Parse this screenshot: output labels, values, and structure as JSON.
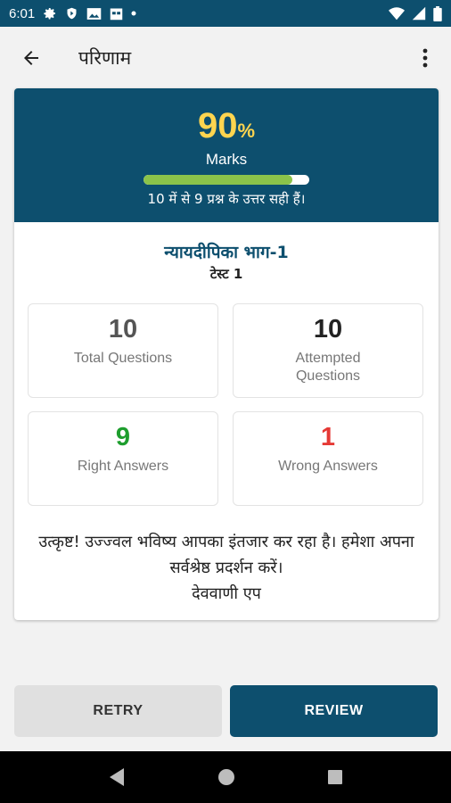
{
  "status_bar": {
    "time": "6:01",
    "icons": [
      "gear-icon",
      "shield-play-icon",
      "image-icon",
      "calendar-icon",
      "dot-icon",
      "wifi-icon",
      "signal-icon",
      "battery-icon"
    ]
  },
  "app_bar": {
    "title": "परिणाम",
    "back_icon": "arrow-left-icon",
    "menu_icon": "more-vertical-icon"
  },
  "score": {
    "value": "90",
    "unit": "%",
    "label": "Marks",
    "progress": 0.9,
    "summary": "10 में से 9 प्रश्न के उत्तर सही हैं।"
  },
  "test": {
    "name": "न्यायदीपिका भाग-1",
    "subtitle": "टेस्ट 1"
  },
  "stats": {
    "total": {
      "value": "10",
      "label": "Total Questions"
    },
    "attempted": {
      "value": "10",
      "label": "Attempted Questions"
    },
    "right": {
      "value": "9",
      "label": "Right Answers"
    },
    "wrong": {
      "value": "1",
      "label": "Wrong Answers"
    }
  },
  "message": {
    "text": "उत्कृष्ट! उज्ज्वल भविष्य आपका इंतजार कर रहा है। हमेशा अपना सर्वश्रेष्ठ प्रदर्शन करें।",
    "signature": "देववाणी एप"
  },
  "buttons": {
    "retry": "RETRY",
    "review": "REVIEW"
  },
  "colors": {
    "primary": "#0d4f6e",
    "score": "#ffd54f",
    "progress": "#8bc34a",
    "right": "#1e9e2e",
    "wrong": "#e53935"
  },
  "nav_bar": {
    "icons": [
      "back-triangle-icon",
      "home-circle-icon",
      "recents-square-icon"
    ]
  }
}
